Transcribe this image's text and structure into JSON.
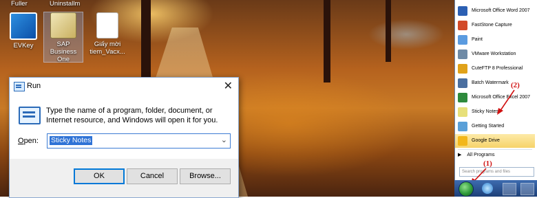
{
  "desktop": {
    "top_cutoff": [
      "Fuller",
      "Uninstallm"
    ],
    "icons": [
      {
        "label": "EVKey"
      },
      {
        "label": "SAP Business One"
      },
      {
        "label": "Giấy mời tiem_Vacx..."
      }
    ]
  },
  "run_dialog": {
    "title": "Run",
    "close_glyph": "✕",
    "description": "Type the name of a program, folder, document, or Internet resource, and Windows will open it for you.",
    "open_label_prefix": "O",
    "open_label_rest": "pen:",
    "open_value": "Sticky Notes",
    "ok_label": "OK",
    "cancel_label": "Cancel",
    "browse_label": "Browse..."
  },
  "start_menu": {
    "items": [
      {
        "label": "Microsoft Office Word 2007",
        "icon": "word-icon",
        "color": "#2b5fb3"
      },
      {
        "label": "FastStone Capture",
        "icon": "faststone-icon",
        "color": "#d24a2a"
      },
      {
        "label": "Paint",
        "icon": "paint-icon",
        "color": "#5a9be0"
      },
      {
        "label": "VMware Workstation",
        "icon": "vmware-icon",
        "color": "#6e8aa6"
      },
      {
        "label": "CuteFTP 8 Professional",
        "icon": "cuteftp-icon",
        "color": "#e0a21a"
      },
      {
        "label": "Batch Watermark",
        "icon": "watermark-icon",
        "color": "#4a6fa0"
      },
      {
        "label": "Microsoft Office Excel 2007",
        "icon": "excel-icon",
        "color": "#2e8a3c"
      },
      {
        "label": "Sticky Notes",
        "icon": "sticky-notes-icon",
        "color": "#e7e07a"
      },
      {
        "label": "Getting Started",
        "icon": "getting-started-icon",
        "color": "#5aa0d8"
      },
      {
        "label": "Google Drive",
        "icon": "google-drive-icon",
        "color": "#f2b71b"
      }
    ],
    "all_programs": "All Programs",
    "search_placeholder": "Search programs and files"
  },
  "annotations": {
    "one": "(1)",
    "two": "(2)"
  }
}
